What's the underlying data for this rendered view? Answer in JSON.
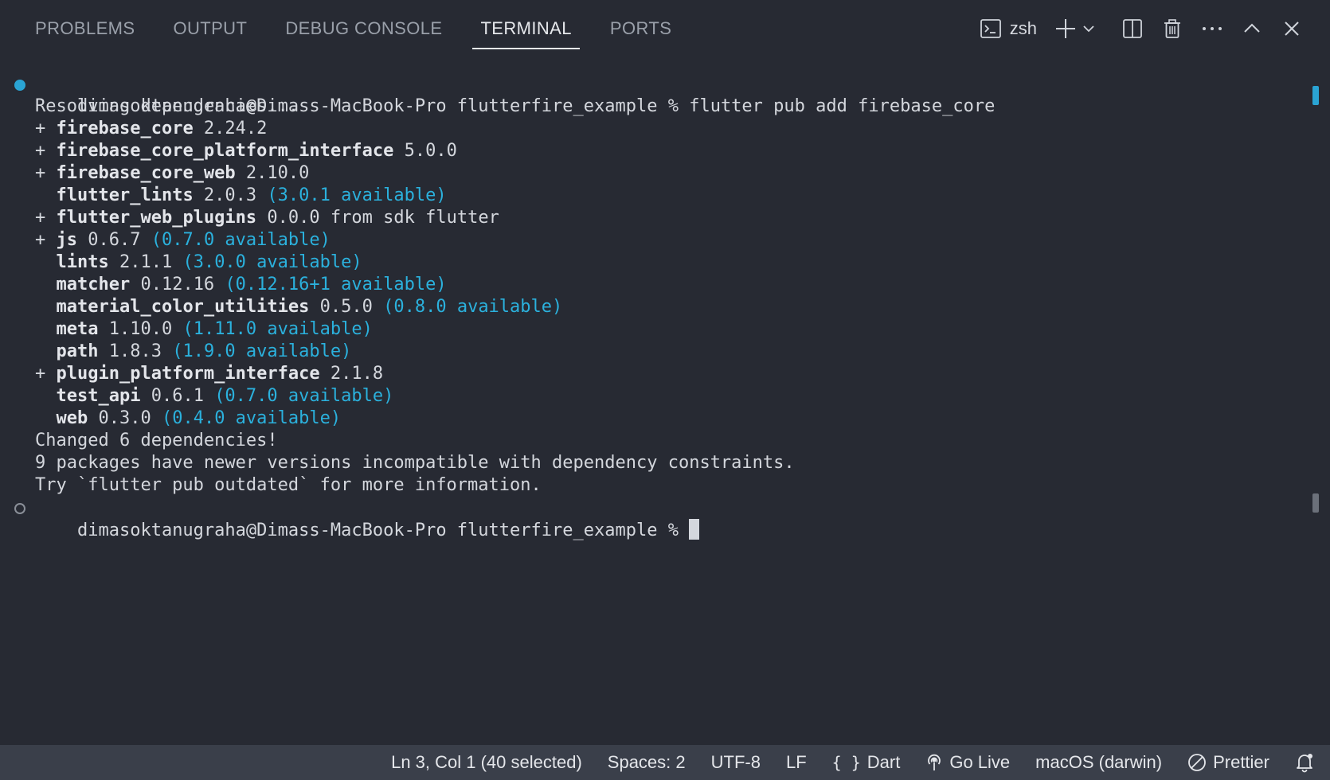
{
  "panel": {
    "tabs": [
      {
        "label": "PROBLEMS"
      },
      {
        "label": "OUTPUT"
      },
      {
        "label": "DEBUG CONSOLE"
      },
      {
        "label": "TERMINAL",
        "active": true
      },
      {
        "label": "PORTS"
      }
    ],
    "terminal_name": "zsh",
    "icons": [
      "terminal-icon",
      "plus-icon",
      "chevron-down-icon",
      "split-icon",
      "trash-icon",
      "ellipsis-icon",
      "chevron-up-icon",
      "close-icon"
    ]
  },
  "terminal": {
    "line1": {
      "prompt": "dimasoktanugraha@Dimass-MacBook-Pro flutterfire_example % ",
      "command": "flutter pub add firebase_core"
    },
    "line2": "Resolving dependencies...",
    "deps": [
      {
        "prefix": "+ ",
        "name": "firebase_core",
        "version": " 2.24.2",
        "extra": ""
      },
      {
        "prefix": "+ ",
        "name": "firebase_core_platform_interface",
        "version": " 5.0.0",
        "extra": ""
      },
      {
        "prefix": "+ ",
        "name": "firebase_core_web",
        "version": " 2.10.0",
        "extra": ""
      },
      {
        "prefix": "  ",
        "name": "flutter_lints",
        "version": " 2.0.3 ",
        "extra": "(3.0.1 available)"
      },
      {
        "prefix": "+ ",
        "name": "flutter_web_plugins",
        "version": " 0.0.0 from sdk flutter",
        "extra": ""
      },
      {
        "prefix": "+ ",
        "name": "js",
        "version": " 0.6.7 ",
        "extra": "(0.7.0 available)"
      },
      {
        "prefix": "  ",
        "name": "lints",
        "version": " 2.1.1 ",
        "extra": "(3.0.0 available)"
      },
      {
        "prefix": "  ",
        "name": "matcher",
        "version": " 0.12.16 ",
        "extra": "(0.12.16+1 available)"
      },
      {
        "prefix": "  ",
        "name": "material_color_utilities",
        "version": " 0.5.0 ",
        "extra": "(0.8.0 available)"
      },
      {
        "prefix": "  ",
        "name": "meta",
        "version": " 1.10.0 ",
        "extra": "(1.11.0 available)"
      },
      {
        "prefix": "  ",
        "name": "path",
        "version": " 1.8.3 ",
        "extra": "(1.9.0 available)"
      },
      {
        "prefix": "+ ",
        "name": "plugin_platform_interface",
        "version": " 2.1.8",
        "extra": ""
      },
      {
        "prefix": "  ",
        "name": "test_api",
        "version": " 0.6.1 ",
        "extra": "(0.7.0 available)"
      },
      {
        "prefix": "  ",
        "name": "web",
        "version": " 0.3.0 ",
        "extra": "(0.4.0 available)"
      }
    ],
    "summary1": "Changed 6 dependencies!",
    "summary2": "9 packages have newer versions incompatible with dependency constraints.",
    "summary3": "Try `flutter pub outdated` for more information.",
    "last_prompt": "dimasoktanugraha@Dimass-MacBook-Pro flutterfire_example % "
  },
  "status_bar": {
    "cursor_position": "Ln 3, Col 1 (40 selected)",
    "indentation": "Spaces: 2",
    "encoding": "UTF-8",
    "line_ending": "LF",
    "language_glyph": "{ }",
    "language": "Dart",
    "go_live": "Go Live",
    "platform": "macOS (darwin)",
    "formatter": "Prettier"
  },
  "colors": {
    "background": "#272a33",
    "status_bar": "#3a3f4a",
    "accent_blue": "#2aa4d4",
    "available_text": "#2bb1dd"
  }
}
